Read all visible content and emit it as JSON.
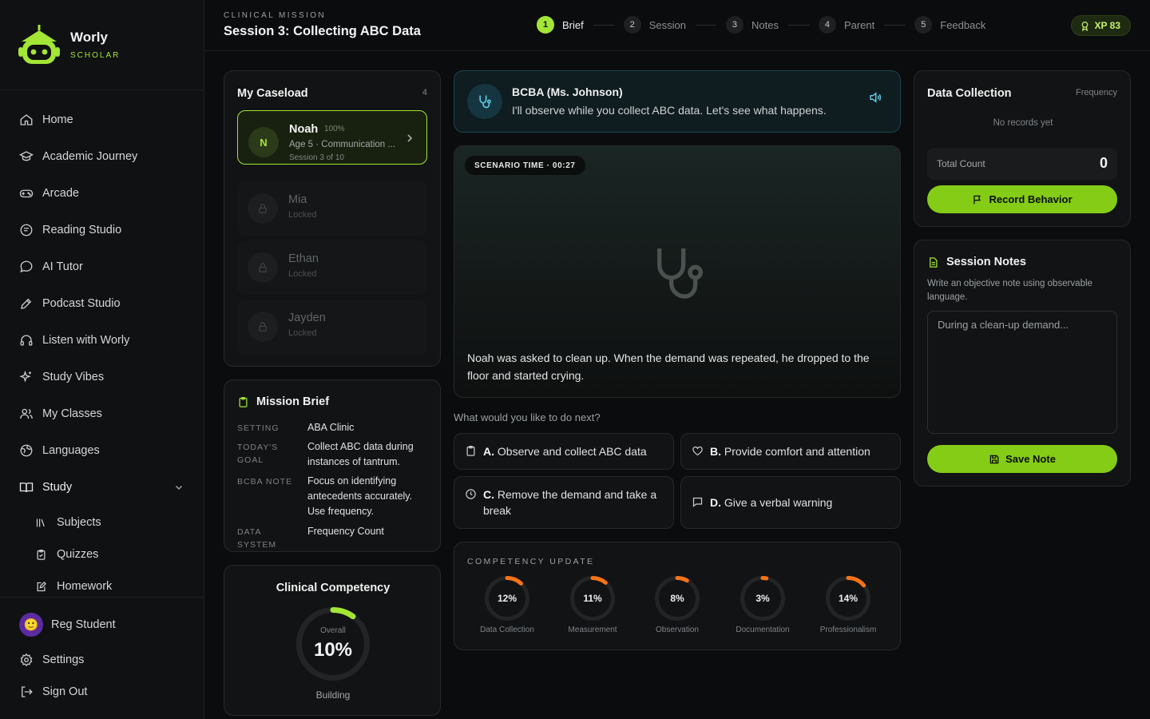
{
  "brand": {
    "name": "Worly",
    "subtitle": "SCHOLAR"
  },
  "nav": [
    {
      "label": "Home",
      "icon": "home-icon"
    },
    {
      "label": "Academic Journey",
      "icon": "graduation-cap-icon"
    },
    {
      "label": "Arcade",
      "icon": "gamepad-icon"
    },
    {
      "label": "Reading Studio",
      "icon": "book-icon"
    },
    {
      "label": "AI Tutor",
      "icon": "chat-bubble-icon"
    },
    {
      "label": "Podcast Studio",
      "icon": "pen-icon"
    },
    {
      "label": "Listen with Worly",
      "icon": "headphones-icon"
    },
    {
      "label": "Study Vibes",
      "icon": "sparkles-icon"
    },
    {
      "label": "My Classes",
      "icon": "users-icon"
    },
    {
      "label": "Languages",
      "icon": "globe-icon"
    },
    {
      "label": "Study",
      "icon": "open-book-icon"
    }
  ],
  "study_sub": [
    {
      "label": "Subjects",
      "icon": "library-icon"
    },
    {
      "label": "Quizzes",
      "icon": "clipboard-check-icon"
    },
    {
      "label": "Homework",
      "icon": "edit-note-icon"
    }
  ],
  "user": {
    "name": "Reg Student",
    "avatar": "🙂"
  },
  "footer_nav": {
    "settings": "Settings",
    "signout": "Sign Out"
  },
  "header": {
    "kicker": "CLINICAL MISSION",
    "title": "Session 3: Collecting ABC Data",
    "steps": [
      {
        "num": "1",
        "label": "Brief"
      },
      {
        "num": "2",
        "label": "Session"
      },
      {
        "num": "3",
        "label": "Notes"
      },
      {
        "num": "4",
        "label": "Parent"
      },
      {
        "num": "5",
        "label": "Feedback"
      }
    ],
    "active_step": 1,
    "xp": "XP 83"
  },
  "caseload": {
    "title": "My Caseload",
    "count": "4",
    "active": {
      "initial": "N",
      "name": "Noah",
      "percent": "100%",
      "detail": "Age 5 · Communication ...",
      "session": "Session 3 of 10"
    },
    "locked": [
      {
        "name": "Mia",
        "status": "Locked"
      },
      {
        "name": "Ethan",
        "status": "Locked"
      },
      {
        "name": "Jayden",
        "status": "Locked"
      }
    ]
  },
  "brief": {
    "title": "Mission Brief",
    "rows": [
      {
        "key": "SETTING",
        "value": "ABA Clinic"
      },
      {
        "key": "TODAY'S GOAL",
        "value": "Collect ABC data during instances of tantrum."
      },
      {
        "key": "BCBA NOTE",
        "value": "Focus on identifying antecedents accurately. Use frequency."
      },
      {
        "key": "DATA SYSTEM",
        "value": "Frequency Count"
      }
    ]
  },
  "competency": {
    "title": "Clinical Competency",
    "overall_label": "Overall",
    "value": "10%",
    "fraction": 0.1,
    "state": "Building"
  },
  "bcba": {
    "name": "BCBA (Ms. Johnson)",
    "message": "I'll observe while you collect ABC data. Let's see what happens."
  },
  "scenario": {
    "time": "SCENARIO TIME · 00:27",
    "caption": "Noah was asked to clean up. When the demand was repeated, he dropped to the floor and started crying."
  },
  "prompt": "What would you like to do next?",
  "options": [
    {
      "letter": "A.",
      "text": "Observe and collect ABC data",
      "icon": "clipboard-icon"
    },
    {
      "letter": "B.",
      "text": "Provide comfort and attention",
      "icon": "heart-icon"
    },
    {
      "letter": "C.",
      "text": "Remove the demand and take a break",
      "icon": "clock-icon"
    },
    {
      "letter": "D.",
      "text": "Give a verbal warning",
      "icon": "message-icon"
    }
  ],
  "update": {
    "title": "COMPETENCY UPDATE",
    "metrics": [
      {
        "value": "12%",
        "label": "Data Collection",
        "fraction": 0.12
      },
      {
        "value": "11%",
        "label": "Measurement",
        "fraction": 0.11
      },
      {
        "value": "8%",
        "label": "Observation",
        "fraction": 0.08
      },
      {
        "value": "3%",
        "label": "Documentation",
        "fraction": 0.03
      },
      {
        "value": "14%",
        "label": "Professionalism",
        "fraction": 0.14
      }
    ]
  },
  "data_collection": {
    "title": "Data Collection",
    "mode": "Frequency",
    "empty": "No records yet",
    "total_label": "Total Count",
    "total_value": "0",
    "button": "Record Behavior"
  },
  "notes": {
    "title": "Session Notes",
    "description": "Write an objective note using observable language.",
    "placeholder": "During a clean-up demand...",
    "button": "Save Note"
  },
  "colors": {
    "accent": "#a3e635",
    "button": "#84cc16",
    "ring": "#f97316",
    "teal": "#5ec8e0"
  }
}
